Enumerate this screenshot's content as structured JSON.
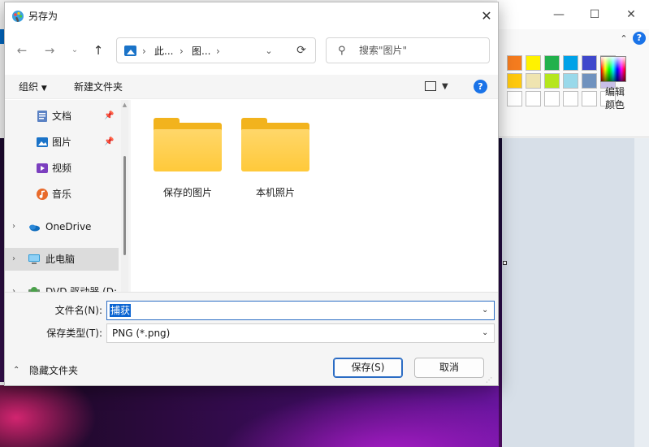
{
  "dialog": {
    "title": "另存为",
    "close_icon": "close-icon"
  },
  "navigation": {
    "back_icon": "arrow-left-icon",
    "forward_icon": "arrow-right-icon",
    "recent_icon": "chevron-down-icon",
    "up_icon": "arrow-up-icon"
  },
  "address": {
    "segments": [
      "此...",
      "图..."
    ],
    "refresh_icon": "refresh-icon"
  },
  "search": {
    "placeholder": "搜索\"图片\""
  },
  "toolbar": {
    "organize_label": "组织",
    "new_folder_label": "新建文件夹",
    "help_label": "?"
  },
  "sidebar": {
    "items": [
      {
        "label": "文档",
        "icon": "document-icon",
        "pinned": true
      },
      {
        "label": "图片",
        "icon": "pictures-icon",
        "pinned": true
      },
      {
        "label": "视频",
        "icon": "video-icon",
        "pinned": false
      },
      {
        "label": "音乐",
        "icon": "music-icon",
        "pinned": false
      },
      {
        "label": "OneDrive",
        "icon": "cloud-icon",
        "expandable": true
      },
      {
        "label": "此电脑",
        "icon": "computer-icon",
        "expandable": true,
        "selected": true
      },
      {
        "label": "DVD 驱动器 (D:",
        "icon": "dvd-drive-icon",
        "expandable": true
      }
    ]
  },
  "content": {
    "folders": [
      {
        "name": "保存的图片"
      },
      {
        "name": "本机照片"
      }
    ]
  },
  "form": {
    "file_name_label": "文件名(N):",
    "file_name_value": "捕获",
    "save_type_label": "保存类型(T):",
    "save_type_value": "PNG (*.png)"
  },
  "footer": {
    "hide_folders_label": "隐藏文件夹",
    "save_label": "保存(S)",
    "cancel_label": "取消"
  },
  "background_app": {
    "edit_colors_label": "编辑\n颜色",
    "palette_row1": [
      "#f57c1f",
      "#fff200",
      "#22b14c",
      "#00a2e8",
      "#3f48cc",
      "#a349a4"
    ],
    "palette_row2": [
      "#ffc90e",
      "#efe4b0",
      "#b5e61d",
      "#99d9ea",
      "#7092be",
      "#c8bfe7"
    ],
    "palette_row3": [
      "#ffffff",
      "#ffffff",
      "#ffffff",
      "#ffffff",
      "#ffffff",
      "#ffffff"
    ]
  },
  "colors": {
    "accent": "#2b6cc4",
    "selection": "#0a64d2",
    "folder": "#ffc93a"
  }
}
